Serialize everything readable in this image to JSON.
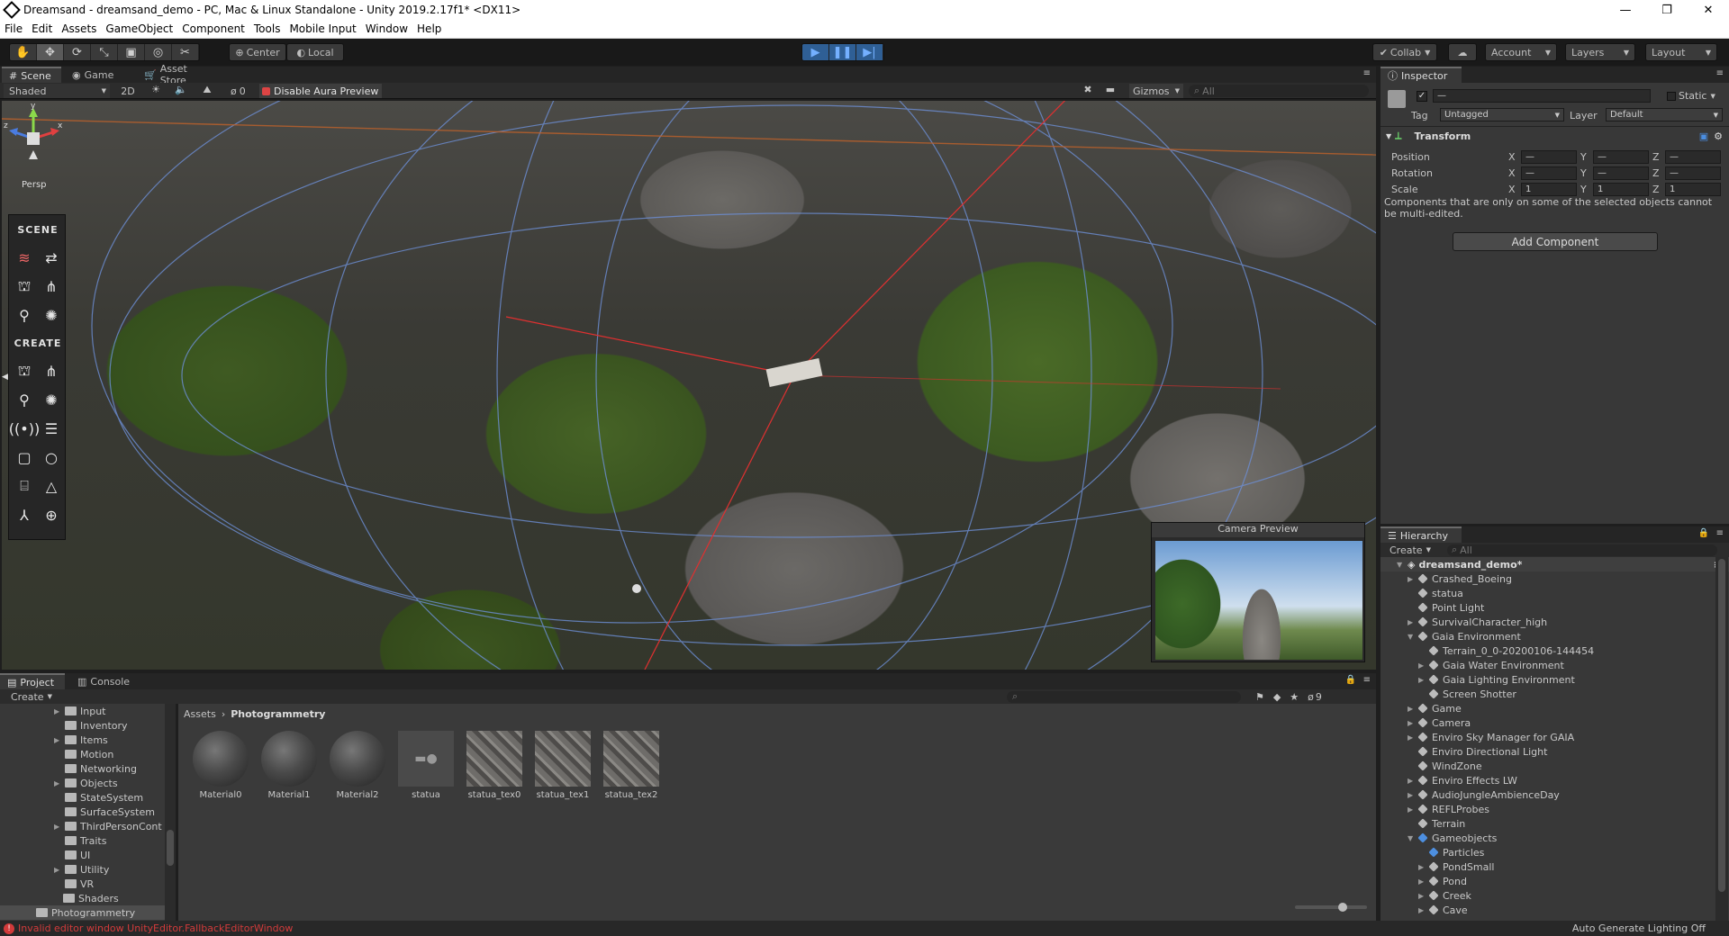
{
  "window": {
    "title": "Dreamsand - dreamsand_demo - PC, Mac & Linux Standalone - Unity 2019.2.17f1* <DX11>"
  },
  "menu": [
    "File",
    "Edit",
    "Assets",
    "GameObject",
    "Component",
    "Tools",
    "Mobile Input",
    "Window",
    "Help"
  ],
  "toolbar": {
    "pivot": "Center",
    "space": "Local",
    "collab": "Collab",
    "account": "Account",
    "layers": "Layers",
    "layout": "Layout"
  },
  "scene": {
    "tabs": [
      "Scene",
      "Game",
      "Asset Store"
    ],
    "shading": "Shaded",
    "mode_2d": "2D",
    "fx_count": "0",
    "aura_button": "Disable Aura Preview",
    "gizmos": "Gizmos",
    "search_placeholder": "All",
    "persp": "Persp",
    "tools_scene_label": "SCENE",
    "tools_create_label": "CREATE",
    "camera_preview_title": "Camera Preview",
    "gizmo_y": "y",
    "gizmo_x": "x",
    "gizmo_z": "z"
  },
  "inspector": {
    "tab": "Inspector",
    "name_value": "—",
    "static_label": "Static",
    "tag_label": "Tag",
    "tag_value": "Untagged",
    "layer_label": "Layer",
    "layer_value": "Default",
    "component": "Transform",
    "rows": [
      {
        "label": "Position",
        "x": "—",
        "y": "—",
        "z": "—"
      },
      {
        "label": "Rotation",
        "x": "—",
        "y": "—",
        "z": "—"
      },
      {
        "label": "Scale",
        "x": "1",
        "y": "1",
        "z": "1"
      }
    ],
    "axis_x": "X",
    "axis_y": "Y",
    "axis_z": "Z",
    "note": "Components that are only on some of the selected objects cannot be multi-edited.",
    "add_component": "Add Component"
  },
  "hierarchy": {
    "tab": "Hierarchy",
    "create": "Create",
    "search_placeholder": "All",
    "scene_name": "dreamsand_demo*",
    "items": [
      {
        "label": "Crashed_Boeing",
        "depth": 1,
        "arrow": true
      },
      {
        "label": "statua",
        "depth": 1,
        "arrow": false
      },
      {
        "label": "Point Light",
        "depth": 1,
        "arrow": false
      },
      {
        "label": "SurvivalCharacter_high",
        "depth": 1,
        "arrow": true
      },
      {
        "label": "Gaia Environment",
        "depth": 1,
        "arrow": true,
        "open": true
      },
      {
        "label": "Terrain_0_0-20200106-144454",
        "depth": 2,
        "arrow": false
      },
      {
        "label": "Gaia Water Environment",
        "depth": 2,
        "arrow": true
      },
      {
        "label": "Gaia Lighting Environment",
        "depth": 2,
        "arrow": true
      },
      {
        "label": "Screen Shotter",
        "depth": 2,
        "arrow": false
      },
      {
        "label": "Game",
        "depth": 1,
        "arrow": true
      },
      {
        "label": "Camera",
        "depth": 1,
        "arrow": true
      },
      {
        "label": "Enviro Sky Manager for GAIA",
        "depth": 1,
        "arrow": true
      },
      {
        "label": "Enviro Directional Light",
        "depth": 1,
        "arrow": false
      },
      {
        "label": "WindZone",
        "depth": 1,
        "arrow": false
      },
      {
        "label": "Enviro Effects LW",
        "depth": 1,
        "arrow": true
      },
      {
        "label": "AudioJungleAmbienceDay",
        "depth": 1,
        "arrow": true
      },
      {
        "label": "REFLProbes",
        "depth": 1,
        "arrow": true
      },
      {
        "label": "Terrain",
        "depth": 1,
        "arrow": false
      },
      {
        "label": "Gameobjects",
        "depth": 1,
        "arrow": true,
        "open": true,
        "blue": true
      },
      {
        "label": "Particles",
        "depth": 2,
        "arrow": false,
        "blue": true
      },
      {
        "label": "PondSmall",
        "depth": 2,
        "arrow": true
      },
      {
        "label": "Pond",
        "depth": 2,
        "arrow": true
      },
      {
        "label": "Creek",
        "depth": 2,
        "arrow": true
      },
      {
        "label": "Cave",
        "depth": 2,
        "arrow": true
      }
    ]
  },
  "project": {
    "tabs": [
      "Project",
      "Console"
    ],
    "create": "Create",
    "badge": "9",
    "breadcrumb": [
      "Assets",
      "Photogrammetry"
    ],
    "folders": [
      {
        "label": "Input",
        "arrow": true
      },
      {
        "label": "Inventory",
        "arrow": false
      },
      {
        "label": "Items",
        "arrow": true
      },
      {
        "label": "Motion",
        "arrow": false
      },
      {
        "label": "Networking",
        "arrow": false
      },
      {
        "label": "Objects",
        "arrow": true
      },
      {
        "label": "StateSystem",
        "arrow": false
      },
      {
        "label": "SurfaceSystem",
        "arrow": false
      },
      {
        "label": "ThirdPersonCont",
        "arrow": true
      },
      {
        "label": "Traits",
        "arrow": false
      },
      {
        "label": "UI",
        "arrow": false
      },
      {
        "label": "Utility",
        "arrow": true
      },
      {
        "label": "VR",
        "arrow": false
      },
      {
        "label": "Shaders",
        "arrow": false
      },
      {
        "label": "Photogrammetry",
        "arrow": false
      }
    ],
    "assets": [
      {
        "label": "Material0",
        "kind": "sphere"
      },
      {
        "label": "Material1",
        "kind": "sphere"
      },
      {
        "label": "Material2",
        "kind": "sphere"
      },
      {
        "label": "statua",
        "kind": "model"
      },
      {
        "label": "statua_tex0",
        "kind": "texture"
      },
      {
        "label": "statua_tex1",
        "kind": "texture"
      },
      {
        "label": "statua_tex2",
        "kind": "texture"
      }
    ]
  },
  "status": {
    "error": "Invalid editor window UnityEditor.FallbackEditorWindow",
    "lighting": "Auto Generate Lighting Off"
  },
  "colors": {
    "play_accent": "#3b82c4",
    "error": "#d23b3b",
    "active_blue": "#4d8fe0"
  }
}
